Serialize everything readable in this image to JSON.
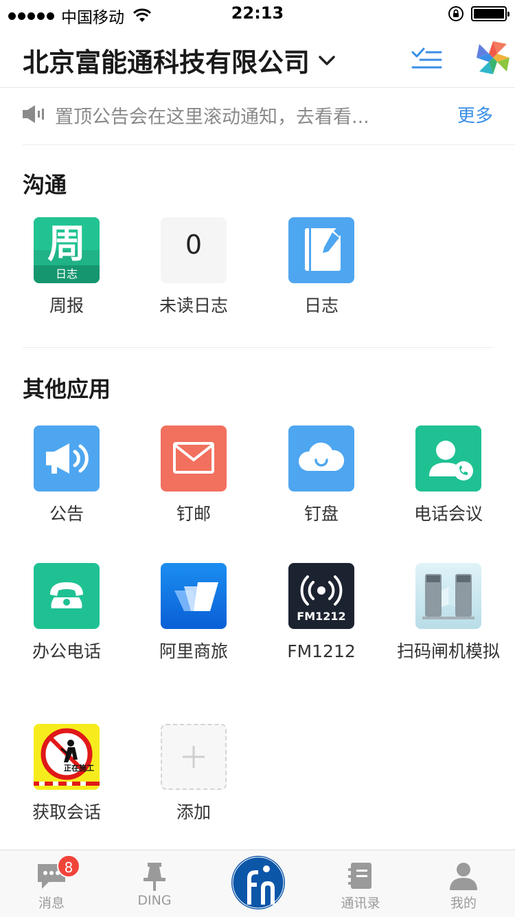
{
  "status_bar": {
    "carrier": "中国移动",
    "time": "22:13"
  },
  "header": {
    "company_name": "北京富能通科技有限公司"
  },
  "notice": {
    "text": "置顶公告会在这里滚动通知，去看看...",
    "more_label": "更多"
  },
  "sections": {
    "communication": {
      "title": "沟通",
      "apps": [
        {
          "label": "周报",
          "icon_char": "周",
          "icon_sub": "日志"
        },
        {
          "label": "未读日志",
          "count": "0"
        },
        {
          "label": "日志"
        }
      ]
    },
    "other": {
      "title": "其他应用",
      "apps": [
        {
          "label": "公告"
        },
        {
          "label": "钉邮"
        },
        {
          "label": "钉盘"
        },
        {
          "label": "电话会议"
        },
        {
          "label": "办公电话"
        },
        {
          "label": "阿里商旅"
        },
        {
          "label": "FM1212",
          "icon_text": "FM1212"
        },
        {
          "label": "扫码闸机模拟"
        },
        {
          "label": "获取会话",
          "icon_text": "正在施工"
        },
        {
          "label": "添加"
        }
      ]
    }
  },
  "tabbar": {
    "items": [
      {
        "label": "消息",
        "badge": "8"
      },
      {
        "label": "DING"
      },
      {
        "label": "通讯录"
      },
      {
        "label": "我的"
      }
    ]
  },
  "colors": {
    "accent_blue": "#3a8ee6",
    "green": "#1fc193",
    "blue_icon": "#4ea6f0",
    "mail_red": "#f2705e",
    "badge_red": "#f0443a"
  }
}
